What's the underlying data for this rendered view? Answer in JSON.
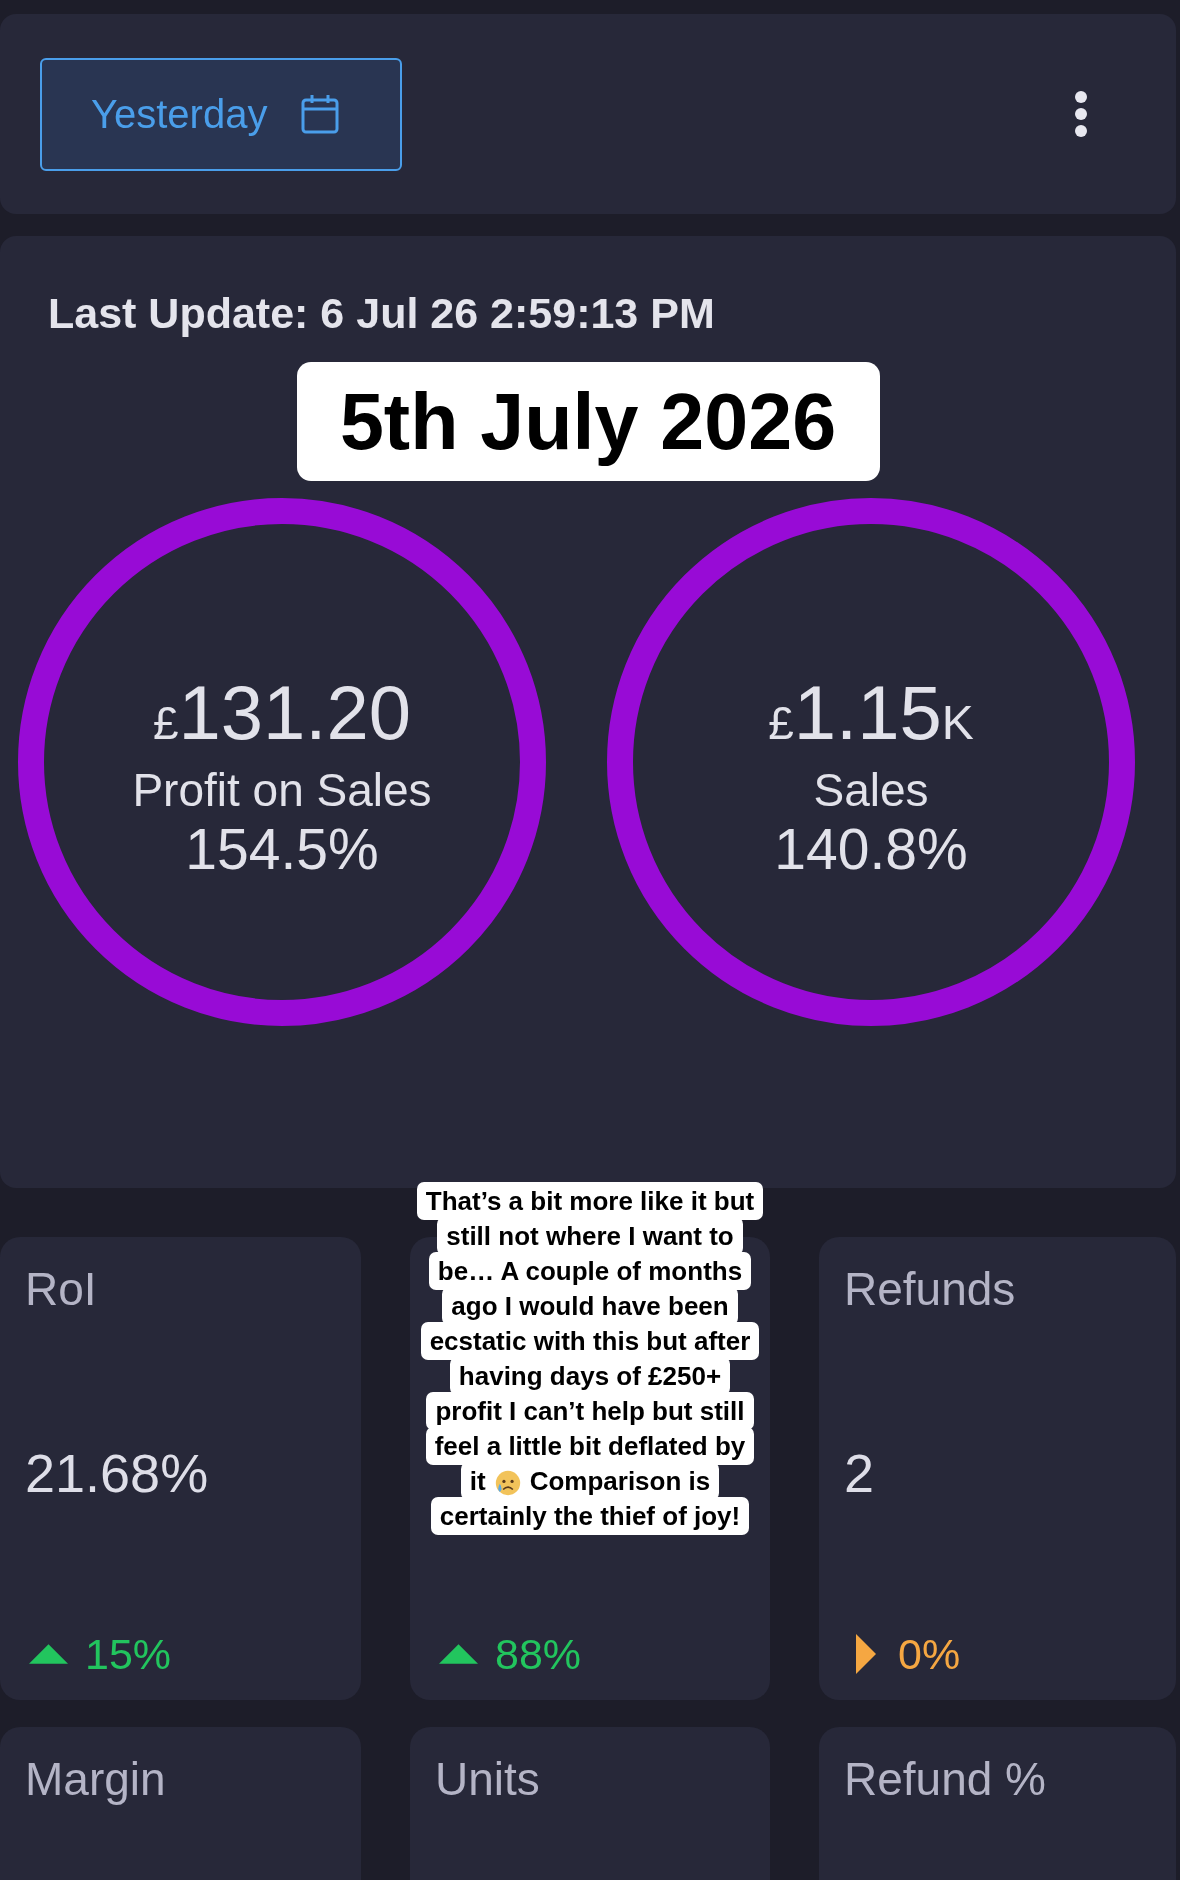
{
  "toolbar": {
    "date_button": {
      "label": "Yesterday"
    }
  },
  "summary": {
    "last_update": "Last Update: 6 Jul 26 2:59:13 PM",
    "date_caption": "5th July 2026",
    "rings": [
      {
        "currency": "£",
        "amount": "131.20",
        "label": "Profit on Sales",
        "percent": "154.5%"
      },
      {
        "currency": "£",
        "amount": "1.15",
        "unit": "K",
        "label": "Sales",
        "percent": "140.8%"
      }
    ]
  },
  "overlay_caption": {
    "lines": [
      {
        "parts": [
          {
            "kind": "text",
            "text": "That’s a bit more like it but"
          }
        ]
      },
      {
        "parts": [
          {
            "kind": "text",
            "text": "still not where I want to"
          }
        ]
      },
      {
        "parts": [
          {
            "kind": "text",
            "text": "be… A couple of months"
          }
        ]
      },
      {
        "parts": [
          {
            "kind": "text",
            "text": "ago I would have been"
          }
        ]
      },
      {
        "parts": [
          {
            "kind": "text",
            "text": "ecstatic with this but after"
          }
        ]
      },
      {
        "parts": [
          {
            "kind": "text",
            "text": "having days of £250+"
          }
        ]
      },
      {
        "parts": [
          {
            "kind": "text",
            "text": "profit I can’t help but still"
          }
        ]
      },
      {
        "parts": [
          {
            "kind": "text",
            "text": "feel a little bit deflated by"
          }
        ]
      },
      {
        "parts": [
          {
            "kind": "text",
            "text": "it"
          },
          {
            "kind": "emoji"
          },
          {
            "kind": "text",
            "text": "Comparison is"
          }
        ]
      },
      {
        "parts": [
          {
            "kind": "text",
            "text": "certainly the thief of joy!"
          }
        ]
      }
    ]
  },
  "metric_cards": [
    {
      "title": "RoI",
      "value": "21.68%",
      "change": {
        "kind": "up",
        "text": "15%"
      }
    },
    {
      "change": {
        "kind": "up",
        "text": "88%"
      }
    },
    {
      "title": "Refunds",
      "value": "2",
      "change": {
        "kind": "flat",
        "text": "0%"
      }
    },
    {
      "title": "Margin"
    },
    {
      "title": "Units"
    },
    {
      "title": "Refund %"
    }
  ]
}
